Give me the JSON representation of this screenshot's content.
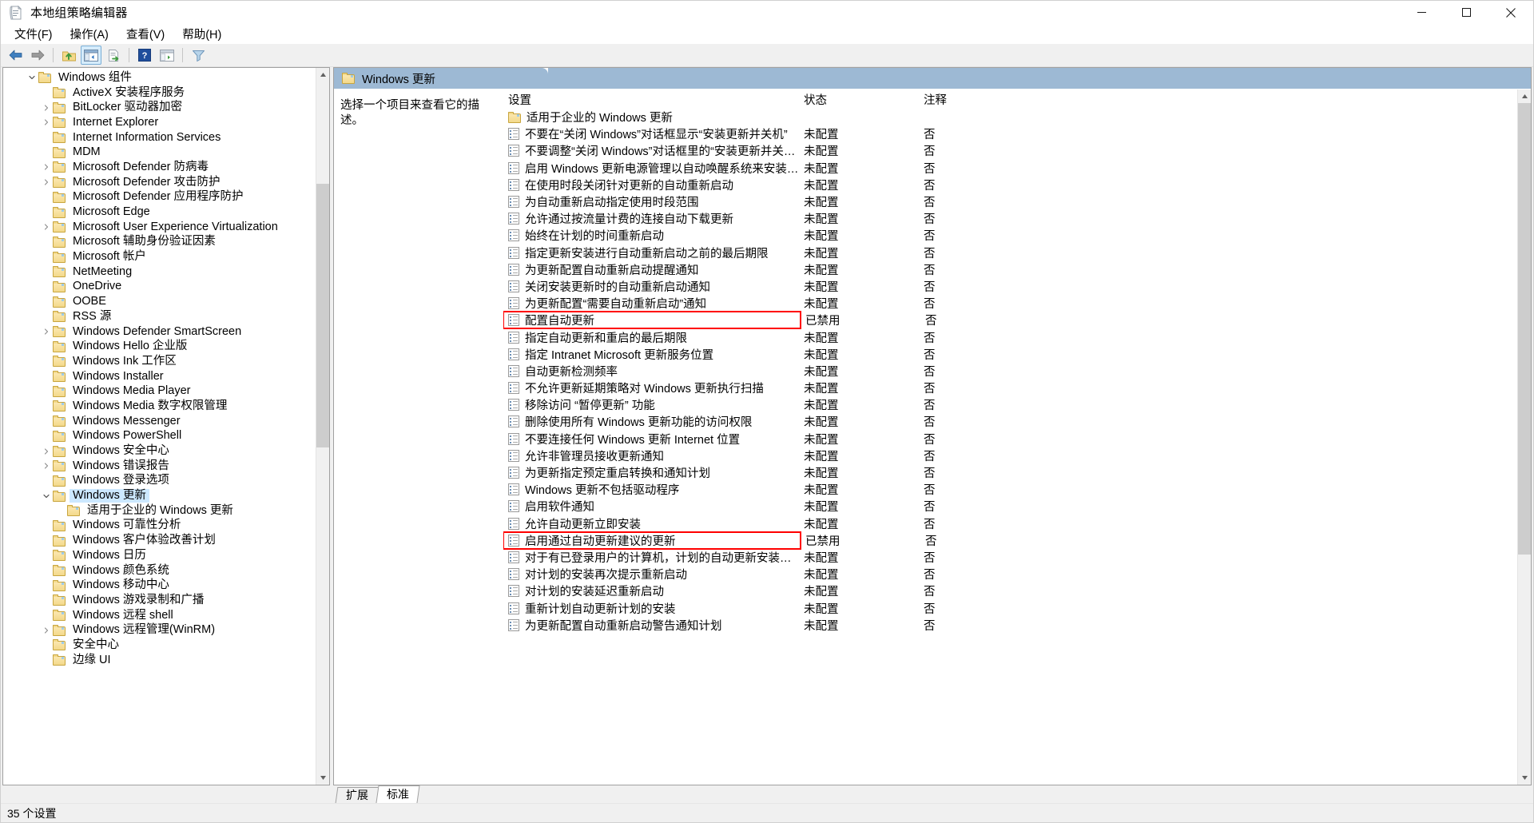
{
  "window": {
    "title": "本地组策略编辑器",
    "icon": "document-policy-icon",
    "minimize_label": "最小化",
    "maximize_label": "最大化",
    "close_label": "关闭"
  },
  "menu": [
    {
      "label": "文件(F)",
      "name": "menu-file"
    },
    {
      "label": "操作(A)",
      "name": "menu-action"
    },
    {
      "label": "查看(V)",
      "name": "menu-view"
    },
    {
      "label": "帮助(H)",
      "name": "menu-help"
    }
  ],
  "toolbar": [
    {
      "name": "back-arrow-icon",
      "kind": "back"
    },
    {
      "name": "forward-arrow-icon",
      "kind": "forward"
    },
    {
      "name": "sep",
      "kind": "sep"
    },
    {
      "name": "up-folder-icon",
      "kind": "upfolder"
    },
    {
      "name": "show-hide-tree-icon",
      "kind": "pane",
      "active": true
    },
    {
      "name": "export-list-icon",
      "kind": "export"
    },
    {
      "name": "sep2",
      "kind": "sep"
    },
    {
      "name": "help-icon",
      "kind": "help"
    },
    {
      "name": "properties-icon",
      "kind": "props"
    },
    {
      "name": "sep3",
      "kind": "sep"
    },
    {
      "name": "filter-icon",
      "kind": "filter"
    }
  ],
  "tree": {
    "items": [
      {
        "label": "Windows 组件",
        "indent": 1,
        "twisty": "expanded",
        "selected": false
      },
      {
        "label": "ActiveX 安装程序服务",
        "indent": 2,
        "twisty": "none",
        "selected": false
      },
      {
        "label": "BitLocker 驱动器加密",
        "indent": 2,
        "twisty": "collapsed",
        "selected": false
      },
      {
        "label": "Internet Explorer",
        "indent": 2,
        "twisty": "collapsed",
        "selected": false
      },
      {
        "label": "Internet Information Services",
        "indent": 2,
        "twisty": "none",
        "selected": false
      },
      {
        "label": "MDM",
        "indent": 2,
        "twisty": "none",
        "selected": false
      },
      {
        "label": "Microsoft Defender 防病毒",
        "indent": 2,
        "twisty": "collapsed",
        "selected": false
      },
      {
        "label": "Microsoft Defender 攻击防护",
        "indent": 2,
        "twisty": "collapsed",
        "selected": false
      },
      {
        "label": "Microsoft Defender 应用程序防护",
        "indent": 2,
        "twisty": "none",
        "selected": false
      },
      {
        "label": "Microsoft Edge",
        "indent": 2,
        "twisty": "none",
        "selected": false
      },
      {
        "label": "Microsoft User Experience Virtualization",
        "indent": 2,
        "twisty": "collapsed",
        "selected": false
      },
      {
        "label": "Microsoft 辅助身份验证因素",
        "indent": 2,
        "twisty": "none",
        "selected": false
      },
      {
        "label": "Microsoft 帐户",
        "indent": 2,
        "twisty": "none",
        "selected": false
      },
      {
        "label": "NetMeeting",
        "indent": 2,
        "twisty": "none",
        "selected": false
      },
      {
        "label": "OneDrive",
        "indent": 2,
        "twisty": "none",
        "selected": false
      },
      {
        "label": "OOBE",
        "indent": 2,
        "twisty": "none",
        "selected": false
      },
      {
        "label": "RSS 源",
        "indent": 2,
        "twisty": "none",
        "selected": false
      },
      {
        "label": "Windows Defender SmartScreen",
        "indent": 2,
        "twisty": "collapsed",
        "selected": false
      },
      {
        "label": "Windows Hello 企业版",
        "indent": 2,
        "twisty": "none",
        "selected": false
      },
      {
        "label": "Windows Ink 工作区",
        "indent": 2,
        "twisty": "none",
        "selected": false
      },
      {
        "label": "Windows Installer",
        "indent": 2,
        "twisty": "none",
        "selected": false
      },
      {
        "label": "Windows Media Player",
        "indent": 2,
        "twisty": "none",
        "selected": false
      },
      {
        "label": "Windows Media 数字权限管理",
        "indent": 2,
        "twisty": "none",
        "selected": false
      },
      {
        "label": "Windows Messenger",
        "indent": 2,
        "twisty": "none",
        "selected": false
      },
      {
        "label": "Windows PowerShell",
        "indent": 2,
        "twisty": "none",
        "selected": false
      },
      {
        "label": "Windows 安全中心",
        "indent": 2,
        "twisty": "collapsed",
        "selected": false
      },
      {
        "label": "Windows 错误报告",
        "indent": 2,
        "twisty": "collapsed",
        "selected": false
      },
      {
        "label": "Windows 登录选项",
        "indent": 2,
        "twisty": "none",
        "selected": false
      },
      {
        "label": "Windows 更新",
        "indent": 2,
        "twisty": "expanded",
        "selected": true
      },
      {
        "label": "适用于企业的 Windows 更新",
        "indent": 3,
        "twisty": "none",
        "selected": false
      },
      {
        "label": "Windows 可靠性分析",
        "indent": 2,
        "twisty": "none",
        "selected": false
      },
      {
        "label": "Windows 客户体验改善计划",
        "indent": 2,
        "twisty": "none",
        "selected": false
      },
      {
        "label": "Windows 日历",
        "indent": 2,
        "twisty": "none",
        "selected": false
      },
      {
        "label": "Windows 颜色系统",
        "indent": 2,
        "twisty": "none",
        "selected": false
      },
      {
        "label": "Windows 移动中心",
        "indent": 2,
        "twisty": "none",
        "selected": false
      },
      {
        "label": "Windows 游戏录制和广播",
        "indent": 2,
        "twisty": "none",
        "selected": false
      },
      {
        "label": "Windows 远程 shell",
        "indent": 2,
        "twisty": "none",
        "selected": false
      },
      {
        "label": "Windows 远程管理(WinRM)",
        "indent": 2,
        "twisty": "collapsed",
        "selected": false
      },
      {
        "label": "安全中心",
        "indent": 2,
        "twisty": "none",
        "selected": false
      },
      {
        "label": "边缘 UI",
        "indent": 2,
        "twisty": "none",
        "selected": false
      }
    ]
  },
  "right": {
    "tab_title": "Windows 更新",
    "description": "选择一个项目来查看它的描述。",
    "columns": {
      "setting": "设置",
      "state": "状态",
      "comment": "注释"
    },
    "rows": [
      {
        "name": "适用于企业的 Windows 更新",
        "state": "",
        "comment": "",
        "icon": "folder",
        "boxed": false
      },
      {
        "name": "不要在“关闭 Windows”对话框显示“安装更新并关机”",
        "state": "未配置",
        "comment": "否",
        "icon": "policy",
        "boxed": false
      },
      {
        "name": "不要调整“关闭 Windows”对话框里的“安装更新并关机”的默...",
        "state": "未配置",
        "comment": "否",
        "icon": "policy",
        "boxed": false
      },
      {
        "name": "启用 Windows 更新电源管理以自动唤醒系统来安装计划的...",
        "state": "未配置",
        "comment": "否",
        "icon": "policy",
        "boxed": false
      },
      {
        "name": "在使用时段关闭针对更新的自动重新启动",
        "state": "未配置",
        "comment": "否",
        "icon": "policy",
        "boxed": false
      },
      {
        "name": "为自动重新启动指定使用时段范围",
        "state": "未配置",
        "comment": "否",
        "icon": "policy",
        "boxed": false
      },
      {
        "name": "允许通过按流量计费的连接自动下载更新",
        "state": "未配置",
        "comment": "否",
        "icon": "policy",
        "boxed": false
      },
      {
        "name": "始终在计划的时间重新启动",
        "state": "未配置",
        "comment": "否",
        "icon": "policy",
        "boxed": false
      },
      {
        "name": "指定更新安装进行自动重新启动之前的最后期限",
        "state": "未配置",
        "comment": "否",
        "icon": "policy",
        "boxed": false
      },
      {
        "name": "为更新配置自动重新启动提醒通知",
        "state": "未配置",
        "comment": "否",
        "icon": "policy",
        "boxed": false
      },
      {
        "name": "关闭安装更新时的自动重新启动通知",
        "state": "未配置",
        "comment": "否",
        "icon": "policy",
        "boxed": false
      },
      {
        "name": "为更新配置“需要自动重新启动”通知",
        "state": "未配置",
        "comment": "否",
        "icon": "policy",
        "boxed": false
      },
      {
        "name": "配置自动更新",
        "state": "已禁用",
        "comment": "否",
        "icon": "policy",
        "boxed": true
      },
      {
        "name": "指定自动更新和重启的最后期限",
        "state": "未配置",
        "comment": "否",
        "icon": "policy",
        "boxed": false
      },
      {
        "name": "指定 Intranet Microsoft 更新服务位置",
        "state": "未配置",
        "comment": "否",
        "icon": "policy",
        "boxed": false
      },
      {
        "name": "自动更新检测频率",
        "state": "未配置",
        "comment": "否",
        "icon": "policy",
        "boxed": false
      },
      {
        "name": "不允许更新延期策略对 Windows 更新执行扫描",
        "state": "未配置",
        "comment": "否",
        "icon": "policy",
        "boxed": false
      },
      {
        "name": "移除访问 “暂停更新” 功能",
        "state": "未配置",
        "comment": "否",
        "icon": "policy",
        "boxed": false
      },
      {
        "name": "删除使用所有 Windows 更新功能的访问权限",
        "state": "未配置",
        "comment": "否",
        "icon": "policy",
        "boxed": false
      },
      {
        "name": "不要连接任何 Windows 更新 Internet 位置",
        "state": "未配置",
        "comment": "否",
        "icon": "policy",
        "boxed": false
      },
      {
        "name": "允许非管理员接收更新通知",
        "state": "未配置",
        "comment": "否",
        "icon": "policy",
        "boxed": false
      },
      {
        "name": "为更新指定预定重启转换和通知计划",
        "state": "未配置",
        "comment": "否",
        "icon": "policy",
        "boxed": false
      },
      {
        "name": "Windows 更新不包括驱动程序",
        "state": "未配置",
        "comment": "否",
        "icon": "policy",
        "boxed": false
      },
      {
        "name": "启用软件通知",
        "state": "未配置",
        "comment": "否",
        "icon": "policy",
        "boxed": false
      },
      {
        "name": "允许自动更新立即安装",
        "state": "未配置",
        "comment": "否",
        "icon": "policy",
        "boxed": false
      },
      {
        "name": "启用通过自动更新建议的更新",
        "state": "已禁用",
        "comment": "否",
        "icon": "policy",
        "boxed": true
      },
      {
        "name": "对于有已登录用户的计算机，计划的自动更新安装不执行重...",
        "state": "未配置",
        "comment": "否",
        "icon": "policy",
        "boxed": false
      },
      {
        "name": "对计划的安装再次提示重新启动",
        "state": "未配置",
        "comment": "否",
        "icon": "policy",
        "boxed": false
      },
      {
        "name": "对计划的安装延迟重新启动",
        "state": "未配置",
        "comment": "否",
        "icon": "policy",
        "boxed": false
      },
      {
        "name": "重新计划自动更新计划的安装",
        "state": "未配置",
        "comment": "否",
        "icon": "policy",
        "boxed": false
      },
      {
        "name": "为更新配置自动重新启动警告通知计划",
        "state": "未配置",
        "comment": "否",
        "icon": "policy",
        "boxed": false
      }
    ],
    "view_tabs": [
      {
        "label": "扩展",
        "active": false
      },
      {
        "label": "标准",
        "active": true
      }
    ]
  },
  "statusbar": {
    "text": "35 个设置"
  },
  "colors": {
    "selection": "#cce8ff",
    "tab_header": "#9db9d4",
    "highlight_box": "#ff0000",
    "folder": "#f3d98a"
  }
}
